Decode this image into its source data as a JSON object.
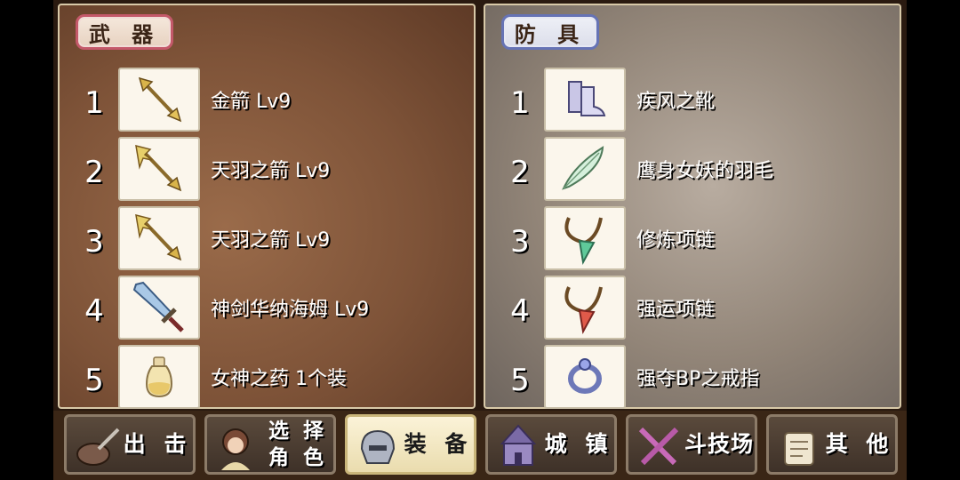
{
  "weapons": {
    "tab_label": "武 器",
    "items": [
      {
        "index": "1",
        "name": "金箭 Lv9",
        "icon": "golden-arrow-icon"
      },
      {
        "index": "2",
        "name": "天羽之箭 Lv9",
        "icon": "feathered-arrow-icon"
      },
      {
        "index": "3",
        "name": "天羽之箭 Lv9",
        "icon": "feathered-arrow-icon"
      },
      {
        "index": "4",
        "name": "神剑华纳海姆 Lv9",
        "icon": "sword-icon"
      },
      {
        "index": "5",
        "name": "女神之药 1个装",
        "icon": "potion-bottle-icon"
      }
    ]
  },
  "armor": {
    "tab_label": "防 具",
    "items": [
      {
        "index": "1",
        "name": "疾风之靴",
        "icon": "boots-icon"
      },
      {
        "index": "2",
        "name": "鹰身女妖的羽毛",
        "icon": "feather-icon"
      },
      {
        "index": "3",
        "name": "修炼项链",
        "icon": "green-necklace-icon"
      },
      {
        "index": "4",
        "name": "强运项链",
        "icon": "red-necklace-icon"
      },
      {
        "index": "5",
        "name": "强夺BP之戒指",
        "icon": "ring-icon"
      }
    ]
  },
  "nav": {
    "sortie": "出 击",
    "select_character": "选 择 角 色",
    "equipment": "装 备",
    "town": "城 镇",
    "arena": "斗技场",
    "other": "其 他"
  }
}
